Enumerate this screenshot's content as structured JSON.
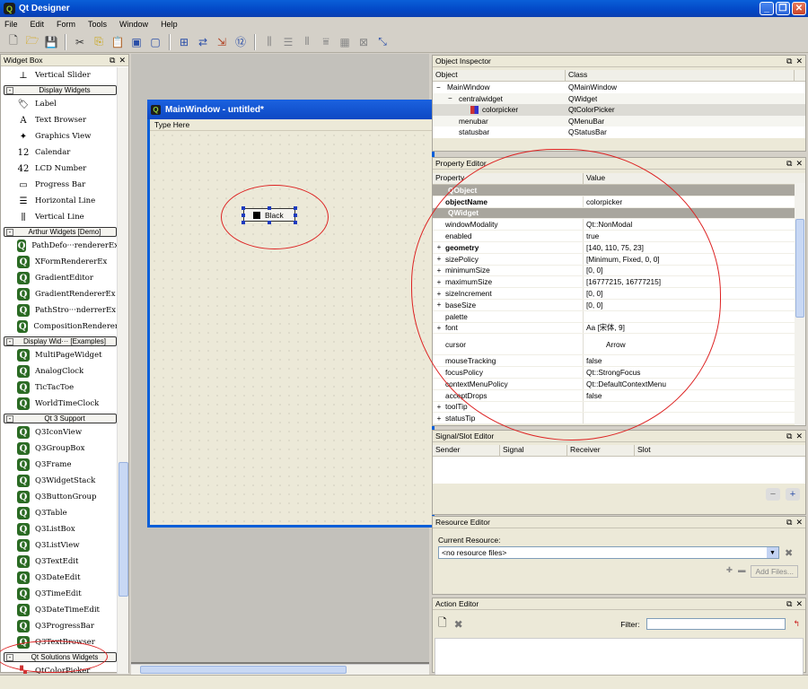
{
  "app": {
    "title": "Qt Designer"
  },
  "menubar": [
    "File",
    "Edit",
    "Form",
    "Tools",
    "Window",
    "Help"
  ],
  "widget_box": {
    "title": "Widget Box",
    "entries": [
      {
        "kind": "item",
        "label": "Vertical Slider",
        "icon": "vertical-slider-icon"
      },
      {
        "kind": "cat",
        "label": "Display Widgets",
        "mark": "-"
      },
      {
        "kind": "item",
        "label": "Label",
        "icon": "label-icon"
      },
      {
        "kind": "item",
        "label": "Text Browser",
        "icon": "text-browser-icon"
      },
      {
        "kind": "item",
        "label": "Graphics View",
        "icon": "graphics-view-icon"
      },
      {
        "kind": "item",
        "label": "Calendar",
        "icon": "calendar-icon"
      },
      {
        "kind": "item",
        "label": "LCD Number",
        "icon": "lcd-number-icon"
      },
      {
        "kind": "item",
        "label": "Progress Bar",
        "icon": "progress-bar-icon"
      },
      {
        "kind": "item",
        "label": "Horizontal Line",
        "icon": "horizontal-line-icon"
      },
      {
        "kind": "item",
        "label": "Vertical Line",
        "icon": "vertical-line-icon"
      },
      {
        "kind": "cat",
        "label": "Arthur Widgets [Demo]",
        "mark": "-"
      },
      {
        "kind": "item",
        "label": "PathDefo···rendererEx",
        "icon": "qt-icon"
      },
      {
        "kind": "item",
        "label": "XFormRendererEx",
        "icon": "qt-icon"
      },
      {
        "kind": "item",
        "label": "GradientEditor",
        "icon": "qt-icon"
      },
      {
        "kind": "item",
        "label": "GradientRendererEx",
        "icon": "qt-icon"
      },
      {
        "kind": "item",
        "label": "PathStro···nderrerEx",
        "icon": "qt-icon"
      },
      {
        "kind": "item",
        "label": "CompositionRenderer",
        "icon": "qt-icon"
      },
      {
        "kind": "cat",
        "label": "Display Wid··· [Examples]",
        "mark": "-"
      },
      {
        "kind": "item",
        "label": "MultiPageWidget",
        "icon": "qt-icon"
      },
      {
        "kind": "item",
        "label": "AnalogClock",
        "icon": "qt-icon"
      },
      {
        "kind": "item",
        "label": "TicTacToe",
        "icon": "qt-icon"
      },
      {
        "kind": "item",
        "label": "WorldTimeClock",
        "icon": "qt-icon"
      },
      {
        "kind": "cat",
        "label": "Qt 3 Support",
        "mark": "-"
      },
      {
        "kind": "item",
        "label": "Q3IconView",
        "icon": "qt-icon"
      },
      {
        "kind": "item",
        "label": "Q3GroupBox",
        "icon": "qt-icon"
      },
      {
        "kind": "item",
        "label": "Q3Frame",
        "icon": "qt-icon"
      },
      {
        "kind": "item",
        "label": "Q3WidgetStack",
        "icon": "qt-icon"
      },
      {
        "kind": "item",
        "label": "Q3ButtonGroup",
        "icon": "qt-icon"
      },
      {
        "kind": "item",
        "label": "Q3Table",
        "icon": "qt-icon"
      },
      {
        "kind": "item",
        "label": "Q3ListBox",
        "icon": "qt-icon"
      },
      {
        "kind": "item",
        "label": "Q3ListView",
        "icon": "qt-icon"
      },
      {
        "kind": "item",
        "label": "Q3TextEdit",
        "icon": "qt-icon"
      },
      {
        "kind": "item",
        "label": "Q3DateEdit",
        "icon": "qt-icon"
      },
      {
        "kind": "item",
        "label": "Q3TimeEdit",
        "icon": "qt-icon"
      },
      {
        "kind": "item",
        "label": "Q3DateTimeEdit",
        "icon": "qt-icon"
      },
      {
        "kind": "item",
        "label": "Q3ProgressBar",
        "icon": "qt-icon"
      },
      {
        "kind": "item",
        "label": "Q3TextBrowser",
        "icon": "qt-icon"
      },
      {
        "kind": "cat",
        "label": "Qt Solutions Widgets",
        "mark": "-"
      },
      {
        "kind": "item",
        "label": "QtColorPicker",
        "icon": "color-picker-icon"
      }
    ]
  },
  "form": {
    "title": "MainWindow - untitled*",
    "menu_placeholder": "Type Here",
    "widget_label": "Black"
  },
  "object_inspector": {
    "title": "Object Inspector",
    "columns": [
      "Object",
      "Class"
    ],
    "rows": [
      {
        "object": "MainWindow",
        "class": "QMainWindow",
        "indent": 0,
        "exp": "−"
      },
      {
        "object": "centralwidget",
        "class": "QWidget",
        "indent": 1,
        "exp": "−"
      },
      {
        "object": "colorpicker",
        "class": "QtColorPicker",
        "indent": 2,
        "exp": ""
      },
      {
        "object": "menubar",
        "class": "QMenuBar",
        "indent": 1,
        "exp": ""
      },
      {
        "object": "statusbar",
        "class": "QStatusBar",
        "indent": 1,
        "exp": ""
      }
    ]
  },
  "property_editor": {
    "title": "Property Editor",
    "columns": [
      "Property",
      "Value"
    ],
    "rows": [
      {
        "type": "grp",
        "key": "QObject"
      },
      {
        "key": "objectName",
        "value": "colorpicker",
        "bold": true
      },
      {
        "type": "grp",
        "key": "QWidget"
      },
      {
        "key": "windowModality",
        "value": "Qt::NonModal"
      },
      {
        "key": "enabled",
        "value": "true"
      },
      {
        "key": "geometry",
        "value": "[140, 110, 75, 23]",
        "bold": true,
        "exp": "+"
      },
      {
        "key": "sizePolicy",
        "value": "[Minimum, Fixed, 0, 0]",
        "exp": "+"
      },
      {
        "key": "minimumSize",
        "value": "[0, 0]",
        "exp": "+"
      },
      {
        "key": "maximumSize",
        "value": "[16777215, 16777215]",
        "exp": "+"
      },
      {
        "key": "sizeIncrement",
        "value": "[0, 0]",
        "exp": "+"
      },
      {
        "key": "baseSize",
        "value": "[0, 0]",
        "exp": "+"
      },
      {
        "key": "palette",
        "value": ""
      },
      {
        "key": "font",
        "value": "Aa  [宋体, 9]",
        "exp": "+"
      },
      {
        "key": "cursor",
        "value": "Arrow",
        "tall": true
      },
      {
        "key": "mouseTracking",
        "value": "false"
      },
      {
        "key": "focusPolicy",
        "value": "Qt::StrongFocus"
      },
      {
        "key": "contextMenuPolicy",
        "value": "Qt::DefaultContextMenu"
      },
      {
        "key": "acceptDrops",
        "value": "false"
      },
      {
        "key": "toolTip",
        "value": "",
        "exp": "+"
      },
      {
        "key": "statusTip",
        "value": "",
        "exp": "+"
      }
    ]
  },
  "signal_slot_editor": {
    "title": "Signal/Slot Editor",
    "columns": [
      "Sender",
      "Signal",
      "Receiver",
      "Slot"
    ]
  },
  "resource_editor": {
    "title": "Resource Editor",
    "current_label": "Current Resource:",
    "combo_value": "<no resource files>",
    "add_files": "Add Files..."
  },
  "action_editor": {
    "title": "Action Editor",
    "filter_label": "Filter:"
  },
  "colors": {
    "titlebar": "#0a5fd8",
    "annotation": "#dd2222",
    "group_row": "#a9a69e"
  }
}
